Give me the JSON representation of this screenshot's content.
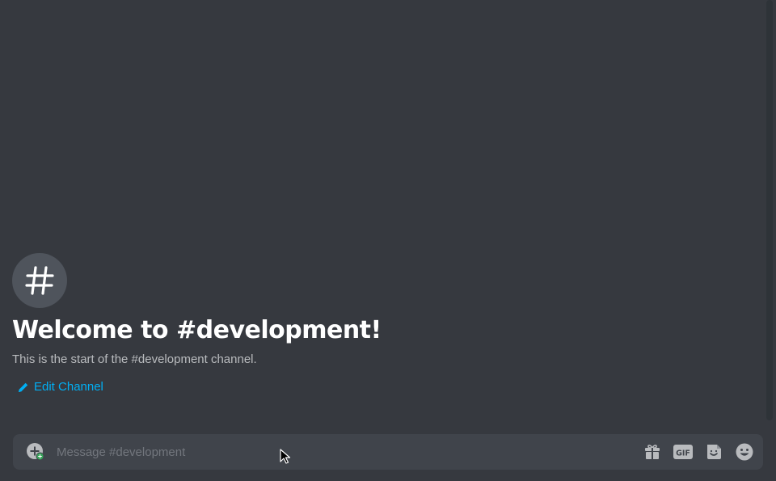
{
  "channel": {
    "name": "development",
    "welcome_title": "Welcome to #development!",
    "welcome_subtitle": "This is the start of the #development channel.",
    "edit_label": "Edit Channel"
  },
  "composer": {
    "placeholder": "Message #development",
    "buttons": [
      {
        "name": "gift-icon"
      },
      {
        "name": "gif-icon",
        "label": "GIF"
      },
      {
        "name": "sticker-icon"
      },
      {
        "name": "emoji-icon"
      }
    ]
  },
  "colors": {
    "background": "#36393f",
    "composer_bg": "#40444b",
    "link": "#00aff4",
    "icon_circle": "#4f545c",
    "icon_gray": "#b9bbbe",
    "online_green": "#3ba55d"
  }
}
